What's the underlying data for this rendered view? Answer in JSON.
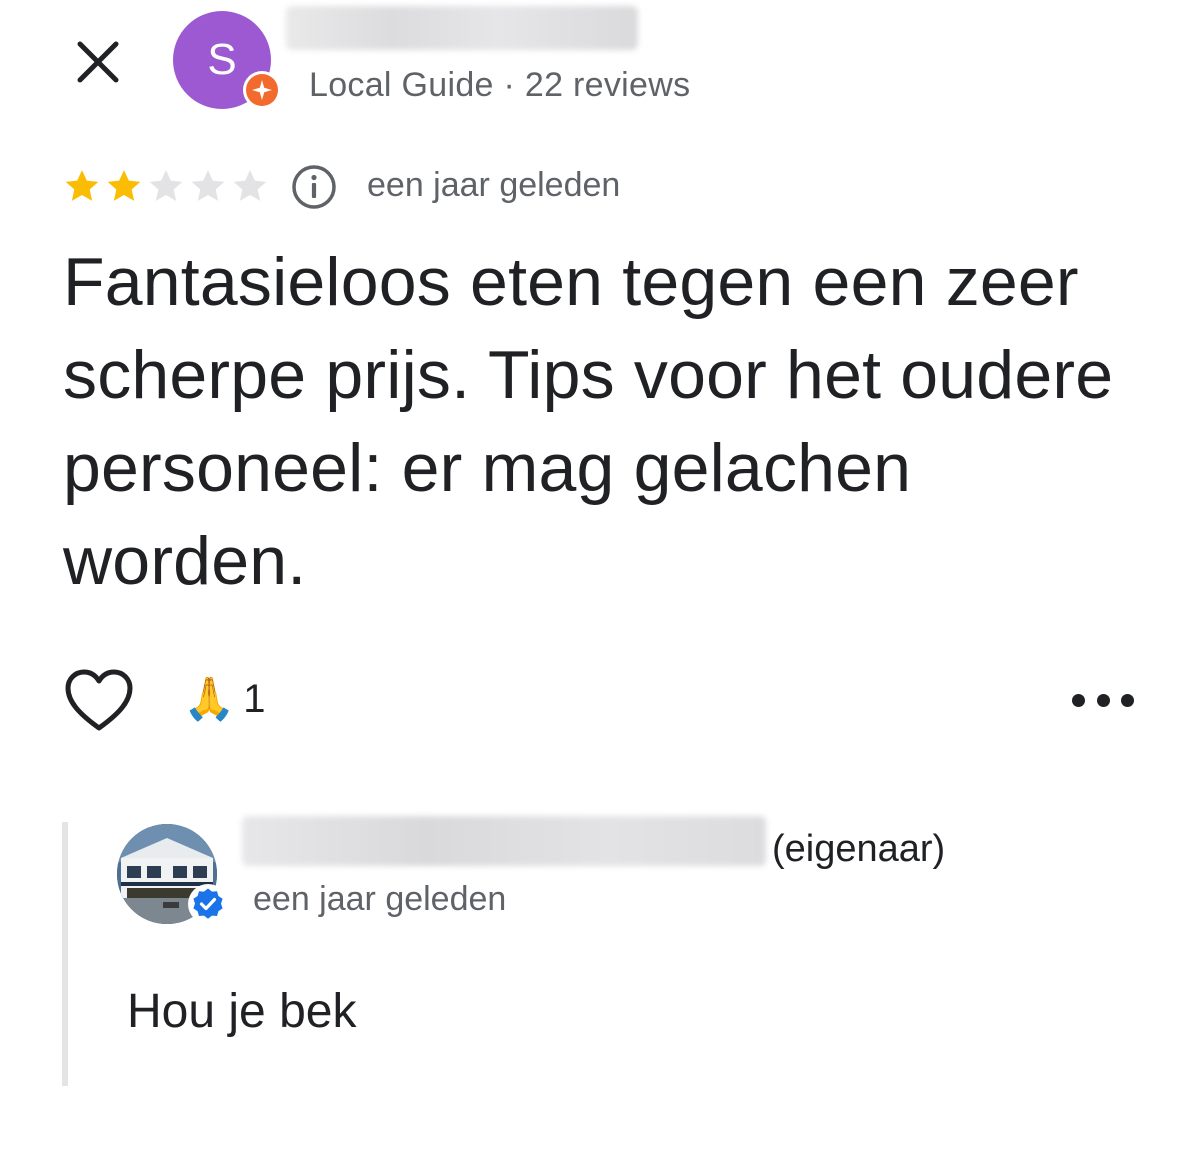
{
  "header": {
    "close_icon": "close-icon",
    "reviewer_initial": "S",
    "reviewer_meta": "Local Guide · 22 reviews",
    "avatar_color": "#9c59d1",
    "local_guide_badge_color": "#f26a2e"
  },
  "rating": {
    "stars": 2,
    "max_stars": 5,
    "star_color": "#fbbc04",
    "time": "een jaar geleden"
  },
  "review": {
    "text": "Fantasieloos eten tegen een zeer scherpe prijs. Tips voor het oudere personeel: er mag gelachen worden."
  },
  "actions": {
    "like_icon": "heart-outline-icon",
    "reaction_emoji": "🙏",
    "reaction_count": "1",
    "more_icon": "more-dots-icon"
  },
  "reply": {
    "owner_role": "(eigenaar)",
    "time": "een jaar geleden",
    "text": "Hou je bek",
    "verified_color": "#1a73e8"
  }
}
